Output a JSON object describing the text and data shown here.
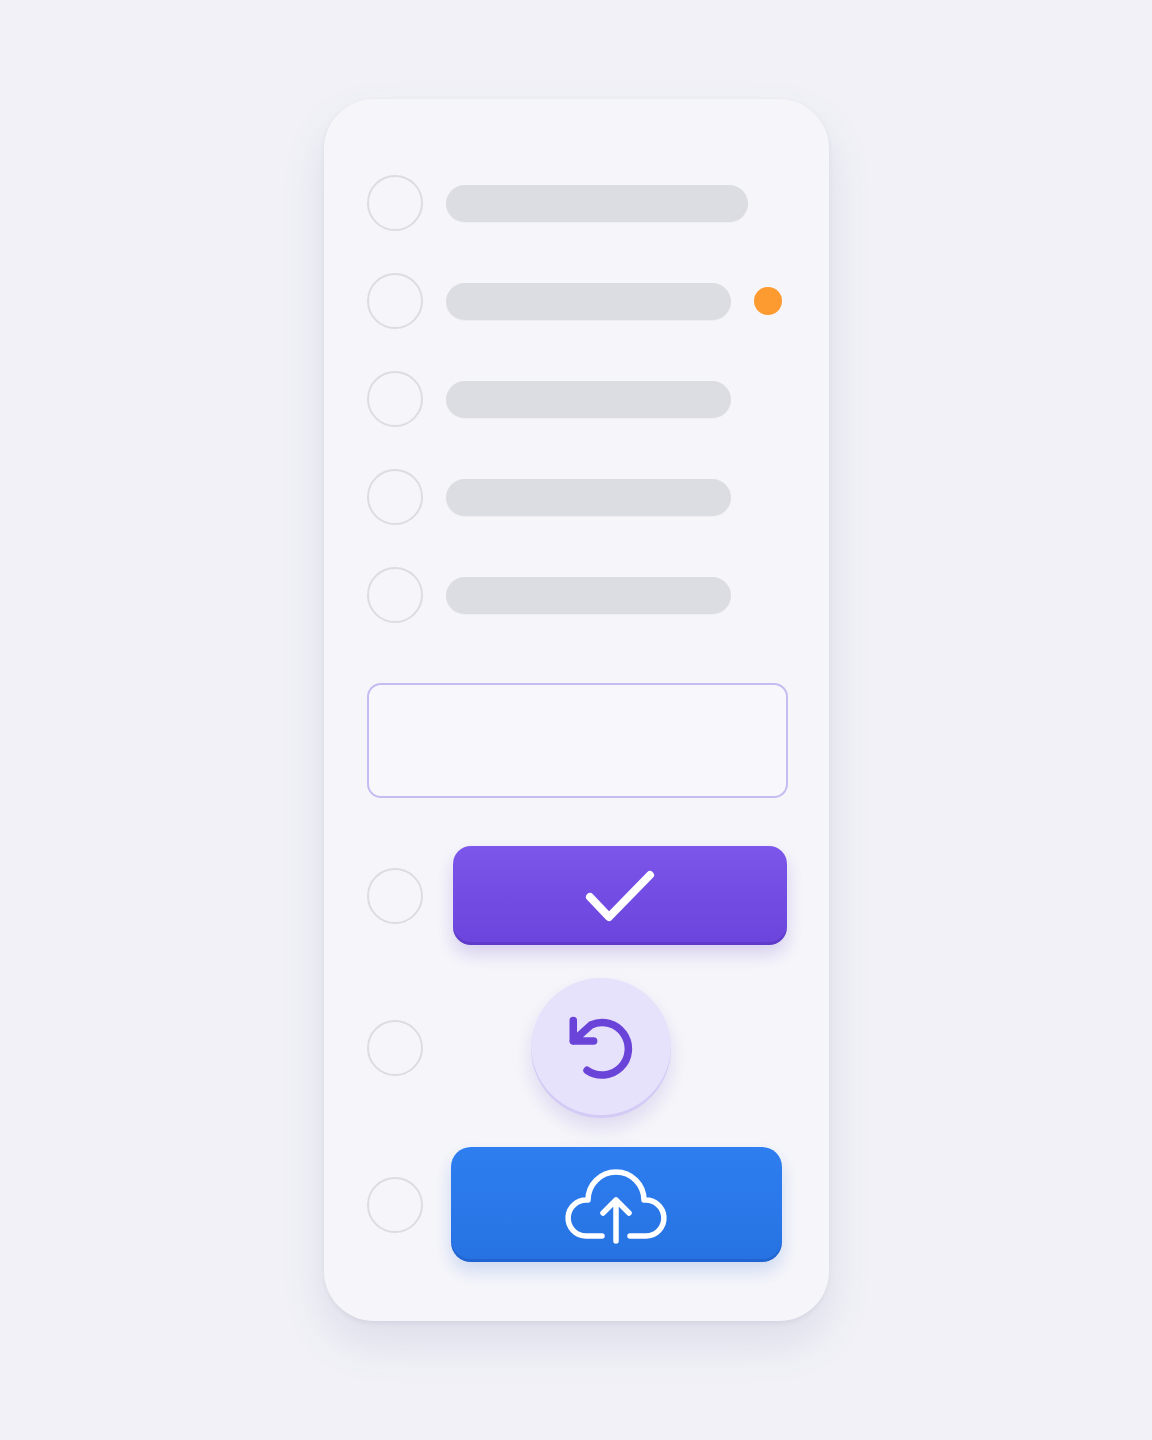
{
  "list_items": [
    {
      "selected": false
    },
    {
      "selected": false,
      "color": "#fd9a30"
    },
    {
      "selected": false
    },
    {
      "selected": false
    },
    {
      "selected": false
    }
  ],
  "input_field": {
    "focused": true
  },
  "actions": [
    {
      "kind": "confirm",
      "selected": false
    },
    {
      "kind": "undo",
      "selected": false
    },
    {
      "kind": "upload",
      "selected": false
    }
  ]
}
